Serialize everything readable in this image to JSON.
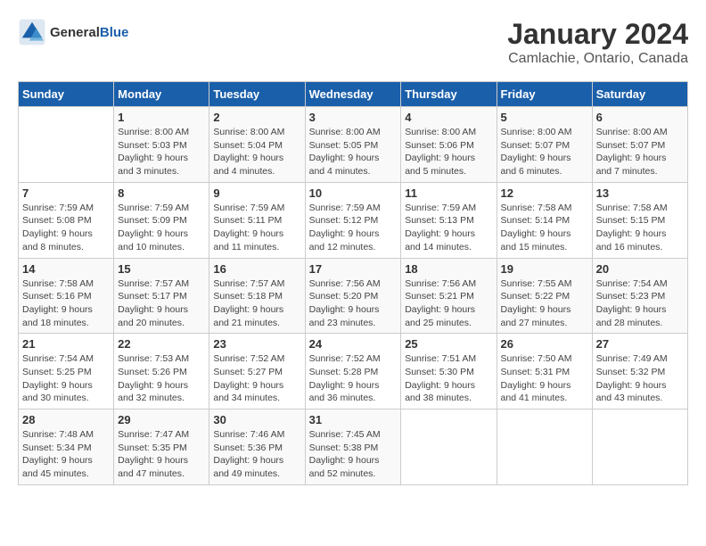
{
  "logo": {
    "text_general": "General",
    "text_blue": "Blue"
  },
  "title": {
    "month": "January 2024",
    "location": "Camlachie, Ontario, Canada"
  },
  "headers": [
    "Sunday",
    "Monday",
    "Tuesday",
    "Wednesday",
    "Thursday",
    "Friday",
    "Saturday"
  ],
  "weeks": [
    [
      {
        "day": "",
        "info": ""
      },
      {
        "day": "1",
        "info": "Sunrise: 8:00 AM\nSunset: 5:03 PM\nDaylight: 9 hours\nand 3 minutes."
      },
      {
        "day": "2",
        "info": "Sunrise: 8:00 AM\nSunset: 5:04 PM\nDaylight: 9 hours\nand 4 minutes."
      },
      {
        "day": "3",
        "info": "Sunrise: 8:00 AM\nSunset: 5:05 PM\nDaylight: 9 hours\nand 4 minutes."
      },
      {
        "day": "4",
        "info": "Sunrise: 8:00 AM\nSunset: 5:06 PM\nDaylight: 9 hours\nand 5 minutes."
      },
      {
        "day": "5",
        "info": "Sunrise: 8:00 AM\nSunset: 5:07 PM\nDaylight: 9 hours\nand 6 minutes."
      },
      {
        "day": "6",
        "info": "Sunrise: 8:00 AM\nSunset: 5:07 PM\nDaylight: 9 hours\nand 7 minutes."
      }
    ],
    [
      {
        "day": "7",
        "info": "Sunrise: 7:59 AM\nSunset: 5:08 PM\nDaylight: 9 hours\nand 8 minutes."
      },
      {
        "day": "8",
        "info": "Sunrise: 7:59 AM\nSunset: 5:09 PM\nDaylight: 9 hours\nand 10 minutes."
      },
      {
        "day": "9",
        "info": "Sunrise: 7:59 AM\nSunset: 5:11 PM\nDaylight: 9 hours\nand 11 minutes."
      },
      {
        "day": "10",
        "info": "Sunrise: 7:59 AM\nSunset: 5:12 PM\nDaylight: 9 hours\nand 12 minutes."
      },
      {
        "day": "11",
        "info": "Sunrise: 7:59 AM\nSunset: 5:13 PM\nDaylight: 9 hours\nand 14 minutes."
      },
      {
        "day": "12",
        "info": "Sunrise: 7:58 AM\nSunset: 5:14 PM\nDaylight: 9 hours\nand 15 minutes."
      },
      {
        "day": "13",
        "info": "Sunrise: 7:58 AM\nSunset: 5:15 PM\nDaylight: 9 hours\nand 16 minutes."
      }
    ],
    [
      {
        "day": "14",
        "info": "Sunrise: 7:58 AM\nSunset: 5:16 PM\nDaylight: 9 hours\nand 18 minutes."
      },
      {
        "day": "15",
        "info": "Sunrise: 7:57 AM\nSunset: 5:17 PM\nDaylight: 9 hours\nand 20 minutes."
      },
      {
        "day": "16",
        "info": "Sunrise: 7:57 AM\nSunset: 5:18 PM\nDaylight: 9 hours\nand 21 minutes."
      },
      {
        "day": "17",
        "info": "Sunrise: 7:56 AM\nSunset: 5:20 PM\nDaylight: 9 hours\nand 23 minutes."
      },
      {
        "day": "18",
        "info": "Sunrise: 7:56 AM\nSunset: 5:21 PM\nDaylight: 9 hours\nand 25 minutes."
      },
      {
        "day": "19",
        "info": "Sunrise: 7:55 AM\nSunset: 5:22 PM\nDaylight: 9 hours\nand 27 minutes."
      },
      {
        "day": "20",
        "info": "Sunrise: 7:54 AM\nSunset: 5:23 PM\nDaylight: 9 hours\nand 28 minutes."
      }
    ],
    [
      {
        "day": "21",
        "info": "Sunrise: 7:54 AM\nSunset: 5:25 PM\nDaylight: 9 hours\nand 30 minutes."
      },
      {
        "day": "22",
        "info": "Sunrise: 7:53 AM\nSunset: 5:26 PM\nDaylight: 9 hours\nand 32 minutes."
      },
      {
        "day": "23",
        "info": "Sunrise: 7:52 AM\nSunset: 5:27 PM\nDaylight: 9 hours\nand 34 minutes."
      },
      {
        "day": "24",
        "info": "Sunrise: 7:52 AM\nSunset: 5:28 PM\nDaylight: 9 hours\nand 36 minutes."
      },
      {
        "day": "25",
        "info": "Sunrise: 7:51 AM\nSunset: 5:30 PM\nDaylight: 9 hours\nand 38 minutes."
      },
      {
        "day": "26",
        "info": "Sunrise: 7:50 AM\nSunset: 5:31 PM\nDaylight: 9 hours\nand 41 minutes."
      },
      {
        "day": "27",
        "info": "Sunrise: 7:49 AM\nSunset: 5:32 PM\nDaylight: 9 hours\nand 43 minutes."
      }
    ],
    [
      {
        "day": "28",
        "info": "Sunrise: 7:48 AM\nSunset: 5:34 PM\nDaylight: 9 hours\nand 45 minutes."
      },
      {
        "day": "29",
        "info": "Sunrise: 7:47 AM\nSunset: 5:35 PM\nDaylight: 9 hours\nand 47 minutes."
      },
      {
        "day": "30",
        "info": "Sunrise: 7:46 AM\nSunset: 5:36 PM\nDaylight: 9 hours\nand 49 minutes."
      },
      {
        "day": "31",
        "info": "Sunrise: 7:45 AM\nSunset: 5:38 PM\nDaylight: 9 hours\nand 52 minutes."
      },
      {
        "day": "",
        "info": ""
      },
      {
        "day": "",
        "info": ""
      },
      {
        "day": "",
        "info": ""
      }
    ]
  ]
}
